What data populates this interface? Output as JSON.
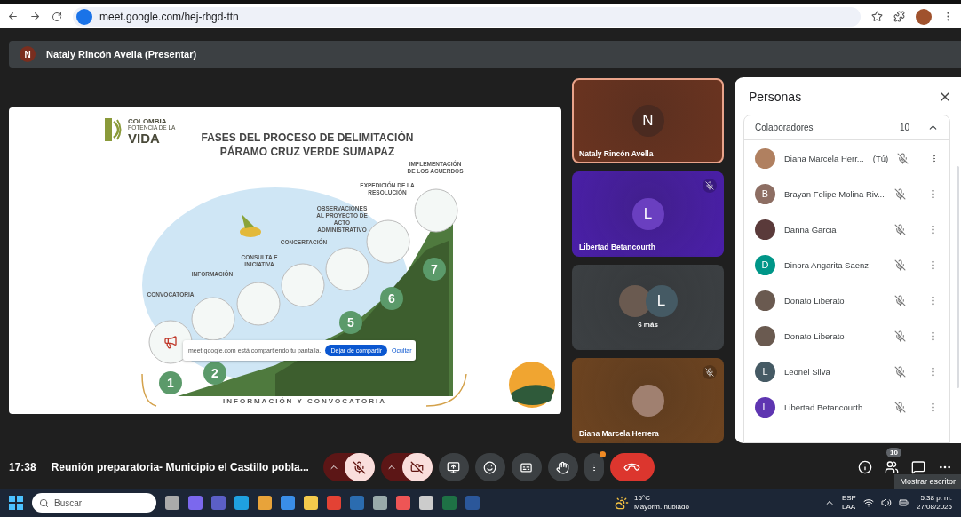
{
  "browser": {
    "url": "meet.google.com/hej-rbgd-ttn"
  },
  "presenter_bar": {
    "initial": "N",
    "label": "Nataly Rincón Avella (Presentar)"
  },
  "slide": {
    "logo": {
      "line_1": "COLOMBIA",
      "line_2": "POTENCIA DE LA",
      "line_3": "VIDA"
    },
    "title_1": "FASES DEL PROCESO DE DELIMITACIÓN",
    "title_2": "PÁRAMO CRUZ VERDE SUMAPAZ",
    "phases": [
      {
        "label": "CONVOCATORIA",
        "number": "1"
      },
      {
        "label": "INFORMACIÓN",
        "number": "2"
      },
      {
        "label": "CONSULTA E INICIATIVA"
      },
      {
        "label": "CONCERTACIÓN"
      },
      {
        "label": "OBSERVACIONES AL PROYECTO DE ACTO ADMINISTRATIVO",
        "number": "5"
      },
      {
        "label": "EXPEDICIÓN DE LA RESOLUCIÓN",
        "number": "6"
      },
      {
        "label": "IMPLEMENTACIÓN DE LOS ACUERDOS",
        "number": "7"
      }
    ],
    "footer": "INFORMACIÓN Y CONVOCATORIA",
    "share_banner": {
      "message": "meet.google.com está compartiendo tu pantalla.",
      "stop_button": "Dejar de compartir",
      "hide_link": "Ocultar"
    }
  },
  "tiles": [
    {
      "kind": "single",
      "name": "Nataly Rincón Avella",
      "initial": "N",
      "highlighted": true,
      "muted": false,
      "color": "#6b3420"
    },
    {
      "kind": "single",
      "name": "Libertad Betancourth",
      "initial": "L",
      "highlighted": false,
      "muted": true,
      "color": "#4a1fa8"
    },
    {
      "kind": "group",
      "initial": "L",
      "label": "6 más",
      "highlighted": false,
      "muted": false,
      "color": "#3c4043"
    },
    {
      "kind": "photo",
      "name": "Diana Marcela Herrera",
      "highlighted": false,
      "muted": true,
      "color": "#6e4420"
    }
  ],
  "people_panel": {
    "title": "Personas",
    "section": {
      "title": "Colaboradores",
      "count": "10",
      "expanded": true
    },
    "people": [
      {
        "name": "Diana Marcela Herr...",
        "suffix": "(Tú)",
        "kind": "photo",
        "muted": true,
        "color": "#b08060"
      },
      {
        "name": "Brayan Felipe Molina Riv...",
        "kind": "letter",
        "initial": "B",
        "muted": true,
        "color": "#8d6e63"
      },
      {
        "name": "Danna Garcia",
        "kind": "photo",
        "muted": true,
        "color": "#5a3a3a"
      },
      {
        "name": "Dinora Angarita Saenz",
        "kind": "letter",
        "initial": "D",
        "muted": true,
        "color": "#009688"
      },
      {
        "name": "Donato Liberato",
        "kind": "photo",
        "muted": true,
        "color": "#6a5a50"
      },
      {
        "name": "Donato Liberato",
        "kind": "photo",
        "muted": true,
        "color": "#6a5a50"
      },
      {
        "name": "Leonel Silva",
        "kind": "letter",
        "initial": "L",
        "muted": true,
        "color": "#455a64"
      },
      {
        "name": "Libertad Betancourth",
        "kind": "letter",
        "initial": "L",
        "muted": true,
        "color": "#5e35b1"
      }
    ]
  },
  "call_bar": {
    "time": "17:38",
    "meeting_title": "Reunión preparatoria- Municipio el Castillo pobla...",
    "controls": [
      {
        "kind": "mic",
        "on": false
      },
      {
        "kind": "camera",
        "on": false
      },
      {
        "kind": "present"
      },
      {
        "kind": "emoji"
      },
      {
        "kind": "captions"
      },
      {
        "kind": "hand"
      },
      {
        "kind": "more",
        "notification": true
      },
      {
        "kind": "hangup"
      }
    ],
    "people_badge": "10",
    "tooltip": "Mostrar escritor"
  },
  "taskbar": {
    "search_placeholder": "Buscar",
    "weather_temp": "15°C",
    "weather_text": "Mayorm. nublado",
    "language": "ESP",
    "layout": "LAA",
    "time": "5:38 p. m.",
    "date": "27/08/2025"
  }
}
